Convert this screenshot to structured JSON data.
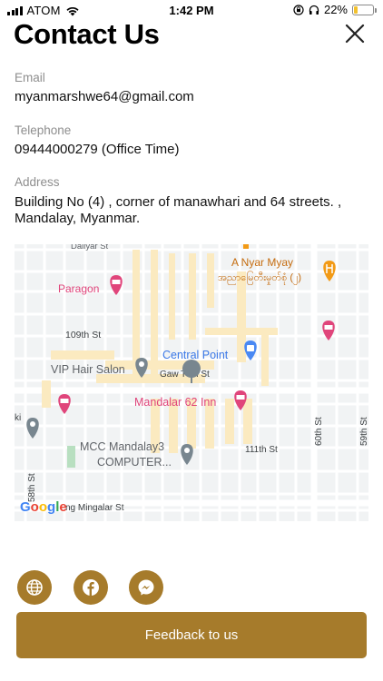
{
  "status_bar": {
    "carrier": "ATOM",
    "time": "1:42 PM",
    "battery": "22%",
    "battery_level": 0.22
  },
  "header": {
    "title": "Contact Us"
  },
  "contact": {
    "email_label": "Email",
    "email": "myanmarshwe64@gmail.com",
    "telephone_label": "Telephone",
    "telephone": "09444000279 (Office Time)",
    "address_label": "Address",
    "address_line1": "Building No (4) , corner of manawhari and 64 streets. ,",
    "address_line2": "Mandalay, Myanmar."
  },
  "map": {
    "street_top": "Daliyar St",
    "place_anyar": "A Nyar Myay",
    "place_anyar_my": "အညာမြေတီးမှုတ်စုံ (၂)",
    "place_paragon": "Paragon",
    "street_109": "109th St",
    "place_central": "Central Point",
    "place_vip": "VIP Hair Salon",
    "street_gaw": "Gaw Tt  in St",
    "place_inn": "Mandalar 62 Inn",
    "place_mcc1": "MCC Mandalay3",
    "place_mcc2": "COMPUTER...",
    "street_111": "111th St",
    "street_60": "60th St",
    "street_59": "59th St",
    "street_58": "58th St",
    "street_mingalar": "ng Mingalar St",
    "street_ki": "ki",
    "google": "Google",
    "colors": {
      "road_major": "#fbeac0",
      "poi_pink": "#e0457b",
      "poi_blue": "#4a89f3",
      "poi_orange": "#f29a16",
      "poi_gray": "#78868f"
    }
  },
  "social": {
    "icons": [
      "globe-icon",
      "facebook-icon",
      "messenger-icon"
    ]
  },
  "feedback_label": "Feedback to us",
  "accent_color": "#a67b2b"
}
